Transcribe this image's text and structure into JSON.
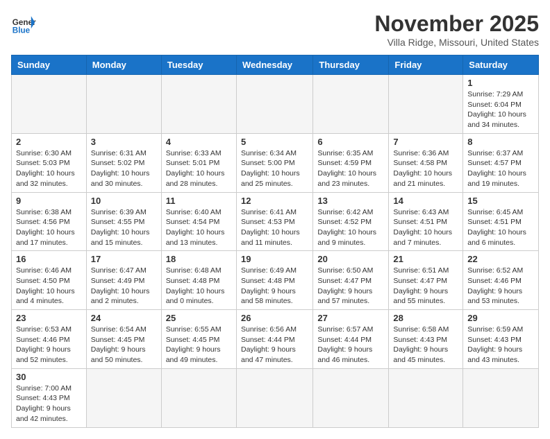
{
  "header": {
    "logo_general": "General",
    "logo_blue": "Blue",
    "month_title": "November 2025",
    "location": "Villa Ridge, Missouri, United States"
  },
  "days_of_week": [
    "Sunday",
    "Monday",
    "Tuesday",
    "Wednesday",
    "Thursday",
    "Friday",
    "Saturday"
  ],
  "weeks": [
    [
      {
        "day": "",
        "info": ""
      },
      {
        "day": "",
        "info": ""
      },
      {
        "day": "",
        "info": ""
      },
      {
        "day": "",
        "info": ""
      },
      {
        "day": "",
        "info": ""
      },
      {
        "day": "",
        "info": ""
      },
      {
        "day": "1",
        "info": "Sunrise: 7:29 AM\nSunset: 6:04 PM\nDaylight: 10 hours and 34 minutes."
      }
    ],
    [
      {
        "day": "2",
        "info": "Sunrise: 6:30 AM\nSunset: 5:03 PM\nDaylight: 10 hours and 32 minutes."
      },
      {
        "day": "3",
        "info": "Sunrise: 6:31 AM\nSunset: 5:02 PM\nDaylight: 10 hours and 30 minutes."
      },
      {
        "day": "4",
        "info": "Sunrise: 6:33 AM\nSunset: 5:01 PM\nDaylight: 10 hours and 28 minutes."
      },
      {
        "day": "5",
        "info": "Sunrise: 6:34 AM\nSunset: 5:00 PM\nDaylight: 10 hours and 25 minutes."
      },
      {
        "day": "6",
        "info": "Sunrise: 6:35 AM\nSunset: 4:59 PM\nDaylight: 10 hours and 23 minutes."
      },
      {
        "day": "7",
        "info": "Sunrise: 6:36 AM\nSunset: 4:58 PM\nDaylight: 10 hours and 21 minutes."
      },
      {
        "day": "8",
        "info": "Sunrise: 6:37 AM\nSunset: 4:57 PM\nDaylight: 10 hours and 19 minutes."
      }
    ],
    [
      {
        "day": "9",
        "info": "Sunrise: 6:38 AM\nSunset: 4:56 PM\nDaylight: 10 hours and 17 minutes."
      },
      {
        "day": "10",
        "info": "Sunrise: 6:39 AM\nSunset: 4:55 PM\nDaylight: 10 hours and 15 minutes."
      },
      {
        "day": "11",
        "info": "Sunrise: 6:40 AM\nSunset: 4:54 PM\nDaylight: 10 hours and 13 minutes."
      },
      {
        "day": "12",
        "info": "Sunrise: 6:41 AM\nSunset: 4:53 PM\nDaylight: 10 hours and 11 minutes."
      },
      {
        "day": "13",
        "info": "Sunrise: 6:42 AM\nSunset: 4:52 PM\nDaylight: 10 hours and 9 minutes."
      },
      {
        "day": "14",
        "info": "Sunrise: 6:43 AM\nSunset: 4:51 PM\nDaylight: 10 hours and 7 minutes."
      },
      {
        "day": "15",
        "info": "Sunrise: 6:45 AM\nSunset: 4:51 PM\nDaylight: 10 hours and 6 minutes."
      }
    ],
    [
      {
        "day": "16",
        "info": "Sunrise: 6:46 AM\nSunset: 4:50 PM\nDaylight: 10 hours and 4 minutes."
      },
      {
        "day": "17",
        "info": "Sunrise: 6:47 AM\nSunset: 4:49 PM\nDaylight: 10 hours and 2 minutes."
      },
      {
        "day": "18",
        "info": "Sunrise: 6:48 AM\nSunset: 4:48 PM\nDaylight: 10 hours and 0 minutes."
      },
      {
        "day": "19",
        "info": "Sunrise: 6:49 AM\nSunset: 4:48 PM\nDaylight: 9 hours and 58 minutes."
      },
      {
        "day": "20",
        "info": "Sunrise: 6:50 AM\nSunset: 4:47 PM\nDaylight: 9 hours and 57 minutes."
      },
      {
        "day": "21",
        "info": "Sunrise: 6:51 AM\nSunset: 4:47 PM\nDaylight: 9 hours and 55 minutes."
      },
      {
        "day": "22",
        "info": "Sunrise: 6:52 AM\nSunset: 4:46 PM\nDaylight: 9 hours and 53 minutes."
      }
    ],
    [
      {
        "day": "23",
        "info": "Sunrise: 6:53 AM\nSunset: 4:46 PM\nDaylight: 9 hours and 52 minutes."
      },
      {
        "day": "24",
        "info": "Sunrise: 6:54 AM\nSunset: 4:45 PM\nDaylight: 9 hours and 50 minutes."
      },
      {
        "day": "25",
        "info": "Sunrise: 6:55 AM\nSunset: 4:45 PM\nDaylight: 9 hours and 49 minutes."
      },
      {
        "day": "26",
        "info": "Sunrise: 6:56 AM\nSunset: 4:44 PM\nDaylight: 9 hours and 47 minutes."
      },
      {
        "day": "27",
        "info": "Sunrise: 6:57 AM\nSunset: 4:44 PM\nDaylight: 9 hours and 46 minutes."
      },
      {
        "day": "28",
        "info": "Sunrise: 6:58 AM\nSunset: 4:43 PM\nDaylight: 9 hours and 45 minutes."
      },
      {
        "day": "29",
        "info": "Sunrise: 6:59 AM\nSunset: 4:43 PM\nDaylight: 9 hours and 43 minutes."
      }
    ],
    [
      {
        "day": "30",
        "info": "Sunrise: 7:00 AM\nSunset: 4:43 PM\nDaylight: 9 hours and 42 minutes."
      },
      {
        "day": "",
        "info": ""
      },
      {
        "day": "",
        "info": ""
      },
      {
        "day": "",
        "info": ""
      },
      {
        "day": "",
        "info": ""
      },
      {
        "day": "",
        "info": ""
      },
      {
        "day": "",
        "info": ""
      }
    ]
  ]
}
